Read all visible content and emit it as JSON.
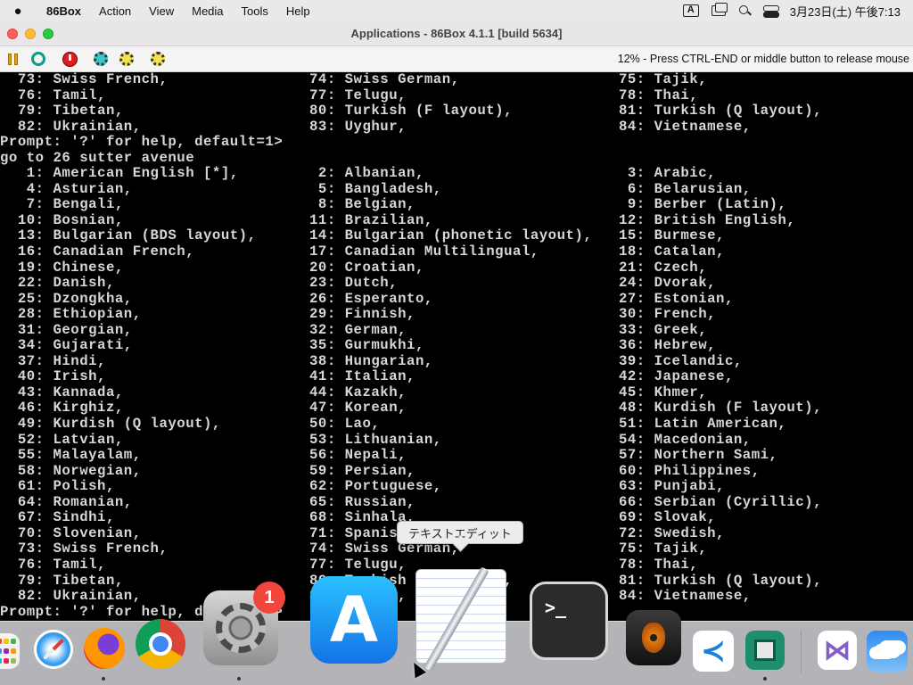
{
  "menubar": {
    "apple": "",
    "app_name": "86Box",
    "items": [
      "Action",
      "View",
      "Media",
      "Tools",
      "Help"
    ],
    "input_indicator": "A",
    "clock": "3月23日(土) 午後7:13"
  },
  "window": {
    "title": "Applications - 86Box 4.1.1 [build 5634]",
    "status": "12% - Press CTRL-END or middle button to release mouse",
    "toolbar_icons": [
      "pause-icon",
      "reset-icon",
      "power-icon",
      "settings-icon",
      "machine-settings-icon",
      "sound-settings-icon"
    ]
  },
  "terminal": {
    "lines": [
      "  73: Swiss French,                74: Swiss German,                  75: Tajik,",
      "  76: Tamil,                       77: Telugu,                        78: Thai,",
      "  79: Tibetan,                     80: Turkish (F layout),            81: Turkish (Q layout),",
      "  82: Ukrainian,                   83: Uyghur,                        84: Vietnamese,",
      "Prompt: '?' for help, default=1>",
      "go to 26 sutter avenue",
      "   1: American English [*],         2: Albanian,                       3: Arabic,",
      "   4: Asturian,                     5: Bangladesh,                     6: Belarusian,",
      "   7: Bengali,                      8: Belgian,                        9: Berber (Latin),",
      "  10: Bosnian,                     11: Brazilian,                     12: British English,",
      "  13: Bulgarian (BDS layout),      14: Bulgarian (phonetic layout),   15: Burmese,",
      "  16: Canadian French,             17: Canadian Multilingual,         18: Catalan,",
      "  19: Chinese,                     20: Croatian,                      21: Czech,",
      "  22: Danish,                      23: Dutch,                         24: Dvorak,",
      "  25: Dzongkha,                    26: Esperanto,                     27: Estonian,",
      "  28: Ethiopian,                   29: Finnish,                       30: French,",
      "  31: Georgian,                    32: German,                        33: Greek,",
      "  34: Gujarati,                    35: Gurmukhi,                      36: Hebrew,",
      "  37: Hindi,                       38: Hungarian,                     39: Icelandic,",
      "  40: Irish,                       41: Italian,                       42: Japanese,",
      "  43: Kannada,                     44: Kazakh,                        45: Khmer,",
      "  46: Kirghiz,                     47: Korean,                        48: Kurdish (F layout),",
      "  49: Kurdish (Q layout),          50: Lao,                           51: Latin American,",
      "  52: Latvian,                     53: Lithuanian,                    54: Macedonian,",
      "  55: Malayalam,                   56: Nepali,                        57: Northern Sami,",
      "  58: Norwegian,                   59: Persian,                       60: Philippines,",
      "  61: Polish,                      62: Portuguese,                    63: Punjabi,",
      "  64: Romanian,                    65: Russian,                       66: Serbian (Cyrillic),",
      "  67: Sindhi,                      68: Sinhala,                       69: Slovak,",
      "  70: Slovenian,                   71: Spanish,                       72: Swedish,",
      "  73: Swiss French,                74: Swiss German,                  75: Tajik,",
      "  76: Tamil,                       77: Telugu,                        78: Thai,",
      "  79: Tibetan,                     80: Turkish (F layout),            81: Turkish (Q layout),",
      "  82: Ukrainian,                   83: Uyghur,                        84: Vietnamese,",
      "Prompt: '?' for help, default=1>"
    ]
  },
  "tooltip": "テキストエディット",
  "dock": {
    "prefs_badge": "1",
    "appstore_glyph": "A",
    "terminal_glyph": ">_",
    "vscode_glyph": "≺",
    "vs_glyph": "⋈",
    "icons": [
      "launchpad-icon",
      "safari-icon",
      "firefox-icon",
      "chrome-icon",
      "system-preferences-icon",
      "app-store-icon",
      "textedit-icon",
      "terminal-icon",
      "garageband-icon",
      "vscode-icon",
      "cpu-monitor-icon",
      "visual-studio-icon",
      "weather-icon"
    ]
  },
  "colors": {
    "terminal_bg": "#000000",
    "terminal_fg": "#d7d7d7",
    "close": "#fe5f57",
    "minimize": "#febc2e",
    "maximize": "#28c840",
    "badge": "#f2453c"
  }
}
